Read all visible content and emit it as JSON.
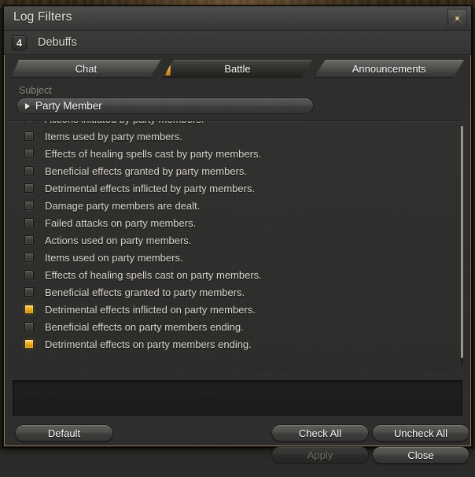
{
  "window": {
    "title": "Log Filters",
    "close_icon": "close-icon"
  },
  "header": {
    "badge_number": "4",
    "title": "Debuffs"
  },
  "tabs": [
    {
      "label": "Chat",
      "active": false
    },
    {
      "label": "Battle",
      "active": true
    },
    {
      "label": "Announcements",
      "active": false
    }
  ],
  "subject": {
    "label": "Subject",
    "selected": "Party Member",
    "caret_icon": "caret-right-icon"
  },
  "filter_list": [
    {
      "label": "Actions initiated by party members.",
      "checked": false
    },
    {
      "label": "Items used by party members.",
      "checked": false
    },
    {
      "label": "Effects of healing spells cast by party members.",
      "checked": false
    },
    {
      "label": "Beneficial effects granted by party members.",
      "checked": false
    },
    {
      "label": "Detrimental effects inflicted by party members.",
      "checked": false
    },
    {
      "label": "Damage party members are dealt.",
      "checked": false
    },
    {
      "label": "Failed attacks on party members.",
      "checked": false
    },
    {
      "label": "Actions used on party members.",
      "checked": false
    },
    {
      "label": "Items used on party members.",
      "checked": false
    },
    {
      "label": "Effects of healing spells cast on party members.",
      "checked": false
    },
    {
      "label": "Beneficial effects granted to party members.",
      "checked": false
    },
    {
      "label": "Detrimental effects inflicted on party members.",
      "checked": true
    },
    {
      "label": "Beneficial effects on party members ending.",
      "checked": false
    },
    {
      "label": "Detrimental effects on party members ending.",
      "checked": true
    }
  ],
  "footer": {
    "default_label": "Default",
    "check_all_label": "Check All",
    "uncheck_all_label": "Uncheck All",
    "apply_label": "Apply",
    "close_label": "Close",
    "apply_enabled": false
  },
  "colors": {
    "accent": "#edb024",
    "border": "#8c7a52",
    "text": "#ded9cd",
    "muted": "#8d8d89"
  }
}
